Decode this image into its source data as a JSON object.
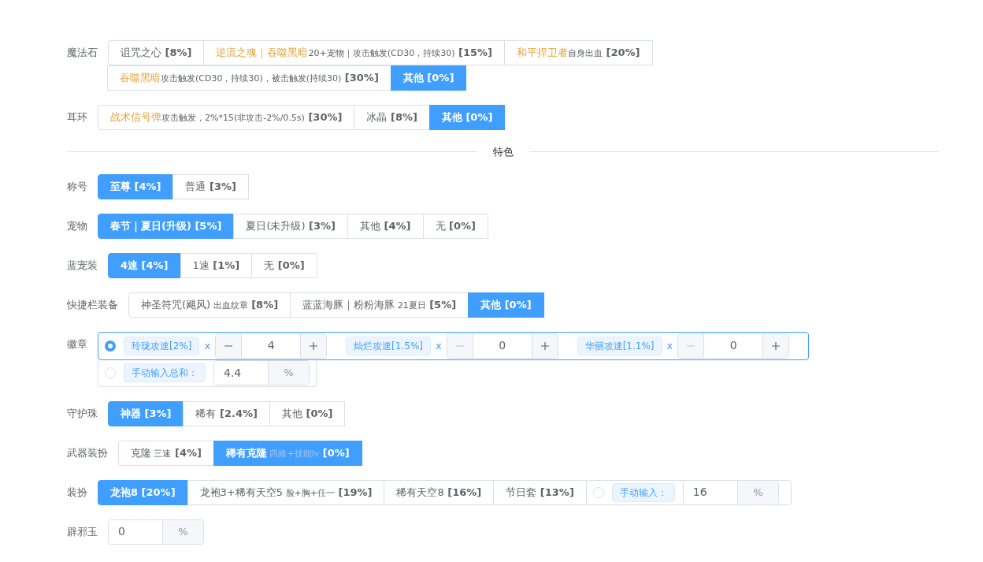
{
  "sections": [
    {
      "kind": "options",
      "label": "魔法石",
      "options": [
        {
          "name": "诅咒之心",
          "highlight": false,
          "value": "[8%]",
          "selected": false
        },
        {
          "name": "逆流之魂｜吞噬黑暗",
          "highlight": true,
          "note": "20+宠物｜攻击触发(CD30，持续30)",
          "value": "[15%]",
          "selected": false
        },
        {
          "name": "和平捍卫者",
          "highlight": true,
          "note": "自身出血",
          "value": "[20%]",
          "selected": false
        },
        {
          "name": "吞噬黑暗",
          "highlight": true,
          "note": "攻击触发(CD30，持续30)，被击触发(持续30)",
          "value": "[30%]",
          "selected": false
        },
        {
          "name": "其他",
          "highlight": false,
          "value": "[0%]",
          "selected": true
        }
      ]
    },
    {
      "kind": "options",
      "label": "耳环",
      "options": [
        {
          "name": "战术信号弹",
          "highlight": true,
          "note": "攻击触发，2%*15(非攻击-2%/0.5s)",
          "value": "[30%]",
          "selected": false
        },
        {
          "name": "冰晶",
          "highlight": false,
          "value": "[8%]",
          "selected": false
        },
        {
          "name": "其他",
          "highlight": false,
          "value": "[0%]",
          "selected": true
        }
      ]
    },
    {
      "kind": "divider",
      "title": "特色"
    },
    {
      "kind": "options",
      "label": "称号",
      "options": [
        {
          "name": "至尊",
          "highlight": false,
          "value": "[4%]",
          "selected": true
        },
        {
          "name": "普通",
          "highlight": false,
          "value": "[3%]",
          "selected": false
        }
      ]
    },
    {
      "kind": "options",
      "label": "宠物",
      "options": [
        {
          "name": "春节｜夏日(升级)",
          "highlight": false,
          "value": "[5%]",
          "selected": true
        },
        {
          "name": "夏日(未升级)",
          "highlight": false,
          "value": "[3%]",
          "selected": false
        },
        {
          "name": "其他",
          "highlight": false,
          "value": "[4%]",
          "selected": false
        },
        {
          "name": "无",
          "highlight": false,
          "value": "[0%]",
          "selected": false
        }
      ]
    },
    {
      "kind": "options",
      "label": "蓝宠装",
      "options": [
        {
          "name": "4速",
          "highlight": false,
          "value": "[4%]",
          "selected": true
        },
        {
          "name": "1速",
          "highlight": false,
          "value": "[1%]",
          "selected": false
        },
        {
          "name": "无",
          "highlight": false,
          "value": "[0%]",
          "selected": false
        }
      ]
    },
    {
      "kind": "options",
      "label": "快捷栏装备",
      "options": [
        {
          "name": "神圣符咒(飓风)",
          "highlight": false,
          "note": "出血纹章",
          "value": "[8%]",
          "selected": false
        },
        {
          "name": "蓝蓝海豚｜粉粉海豚",
          "highlight": false,
          "note": "21夏日",
          "value": "[5%]",
          "selected": false
        },
        {
          "name": "其他",
          "highlight": false,
          "value": "[0%]",
          "selected": true
        }
      ]
    },
    {
      "kind": "emblem",
      "label": "徽章",
      "choices": [
        {
          "kind": "steppers",
          "selected": true,
          "items": [
            {
              "tag": "玲珑攻速[2%]",
              "times": "x",
              "value": "4",
              "minus_disabled": false
            },
            {
              "tag": "灿烂攻速[1.5%]",
              "times": "x",
              "value": "0",
              "minus_disabled": true
            },
            {
              "tag": "华丽攻速[1.1%]",
              "times": "x",
              "value": "0",
              "minus_disabled": true
            }
          ]
        },
        {
          "kind": "manual",
          "selected": false,
          "tag": "手动输入总和：",
          "value": "4.4",
          "unit": "%"
        }
      ]
    },
    {
      "kind": "options",
      "label": "守护珠",
      "options": [
        {
          "name": "神器",
          "highlight": false,
          "value": "[3%]",
          "selected": true
        },
        {
          "name": "稀有",
          "highlight": false,
          "value": "[2.4%]",
          "selected": false
        },
        {
          "name": "其他",
          "highlight": false,
          "value": "[0%]",
          "selected": false
        }
      ]
    },
    {
      "kind": "options",
      "label": "武器装扮",
      "options": [
        {
          "name": "克隆",
          "highlight": false,
          "note": "三速",
          "value": "[4%]",
          "selected": false
        },
        {
          "name": "稀有克隆",
          "highlight": false,
          "note": "四維+技能lv",
          "value": "[0%]",
          "selected": true
        }
      ]
    },
    {
      "kind": "options",
      "label": "装扮",
      "options": [
        {
          "name": "龙袍8",
          "highlight": false,
          "value": "[20%]",
          "selected": true
        },
        {
          "name": "龙袍3+稀有天空5",
          "highlight": false,
          "note": "脸+胸+任一",
          "value": "[19%]",
          "selected": false
        },
        {
          "name": "稀有天空8",
          "highlight": false,
          "value": "[16%]",
          "selected": false
        },
        {
          "name": "节日套",
          "highlight": false,
          "value": "[13%]",
          "selected": false
        }
      ],
      "manual": {
        "selected": false,
        "tag": "手动输入：",
        "value": "16",
        "unit": "%"
      }
    },
    {
      "kind": "input",
      "label": "辟邪玉",
      "value": "0",
      "unit": "%"
    }
  ]
}
